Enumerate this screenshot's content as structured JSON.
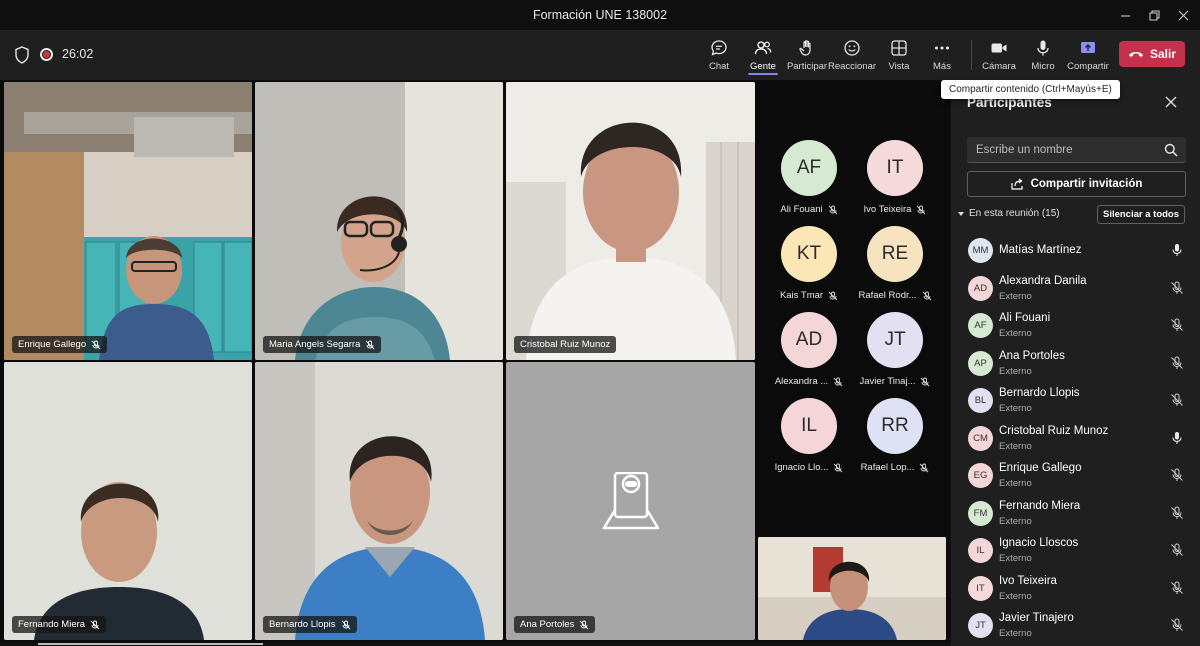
{
  "window": {
    "title": "Formación UNE 138002"
  },
  "toolbar": {
    "timer": "26:02",
    "buttons": {
      "chat": "Chat",
      "gente": "Gente",
      "participar": "Participar",
      "reaccionar": "Reaccionar",
      "vista": "Vista",
      "mas": "Más",
      "camara": "Cámara",
      "micro": "Micro",
      "compartir": "Compartir"
    },
    "leave": "Salir",
    "tooltip": "Compartir contenido (Ctrl+Mayús+E)"
  },
  "tiles": [
    {
      "name": "Enrique Gallego"
    },
    {
      "name": "Maria Angels Segarra"
    },
    {
      "name": "Cristobal Ruiz Munoz"
    },
    {
      "name": "Fernando Miera"
    },
    {
      "name": "Bernardo Llopis"
    },
    {
      "name": "Ana Portoles"
    }
  ],
  "avatars": [
    {
      "initials": "AF",
      "name": "Ali Fouani",
      "color": "#d6ead2"
    },
    {
      "initials": "IT",
      "name": "Ivo Teixeira",
      "color": "#f6d9db"
    },
    {
      "initials": "KT",
      "name": "Kais Tmar",
      "color": "#fbe7b5"
    },
    {
      "initials": "RE",
      "name": "Rafael Rodr...",
      "color": "#f7e3c0"
    },
    {
      "initials": "AD",
      "name": "Alexandra ...",
      "color": "#f5d6d8"
    },
    {
      "initials": "JT",
      "name": "Javier Tinaj...",
      "color": "#e3e0f4"
    },
    {
      "initials": "IL",
      "name": "Ignacio Llo...",
      "color": "#f5d5d8"
    },
    {
      "initials": "RR",
      "name": "Rafael Lop...",
      "color": "#dfe1f4"
    }
  ],
  "panel": {
    "title": "Participantes",
    "search_placeholder": "Escribe un nombre",
    "share_invite": "Compartir invitación",
    "in_meeting": "En esta reunión (15)",
    "mute_all": "Silenciar a todos",
    "participants": [
      {
        "initials": "MM",
        "name": "Matías Martínez",
        "role": "",
        "color": "#dfe6f2",
        "muted": false
      },
      {
        "initials": "AD",
        "name": "Alexandra Danila",
        "role": "Externo",
        "color": "#f5d6d8",
        "muted": true
      },
      {
        "initials": "AF",
        "name": "Ali Fouani",
        "role": "Externo",
        "color": "#d6ead2",
        "muted": true
      },
      {
        "initials": "AP",
        "name": "Ana Portoles",
        "role": "Externo",
        "color": "#d6ead2",
        "muted": true
      },
      {
        "initials": "BL",
        "name": "Bernardo Llopis",
        "role": "Externo",
        "color": "#e3e0f4",
        "muted": true
      },
      {
        "initials": "CM",
        "name": "Cristobal Ruiz Munoz",
        "role": "Externo",
        "color": "#f5d6d8",
        "muted": false
      },
      {
        "initials": "EG",
        "name": "Enrique Gallego",
        "role": "Externo",
        "color": "#f5d6d8",
        "muted": true
      },
      {
        "initials": "FM",
        "name": "Fernando Miera",
        "role": "Externo",
        "color": "#d6ead2",
        "muted": true
      },
      {
        "initials": "IL",
        "name": "Ignacio Lloscos",
        "role": "Externo",
        "color": "#f5d6d8",
        "muted": true
      },
      {
        "initials": "IT",
        "name": "Ivo Teixeira",
        "role": "Externo",
        "color": "#f6d9db",
        "muted": true
      },
      {
        "initials": "JT",
        "name": "Javier Tinajero",
        "role": "Externo",
        "color": "#e3e0f4",
        "muted": true
      }
    ]
  }
}
